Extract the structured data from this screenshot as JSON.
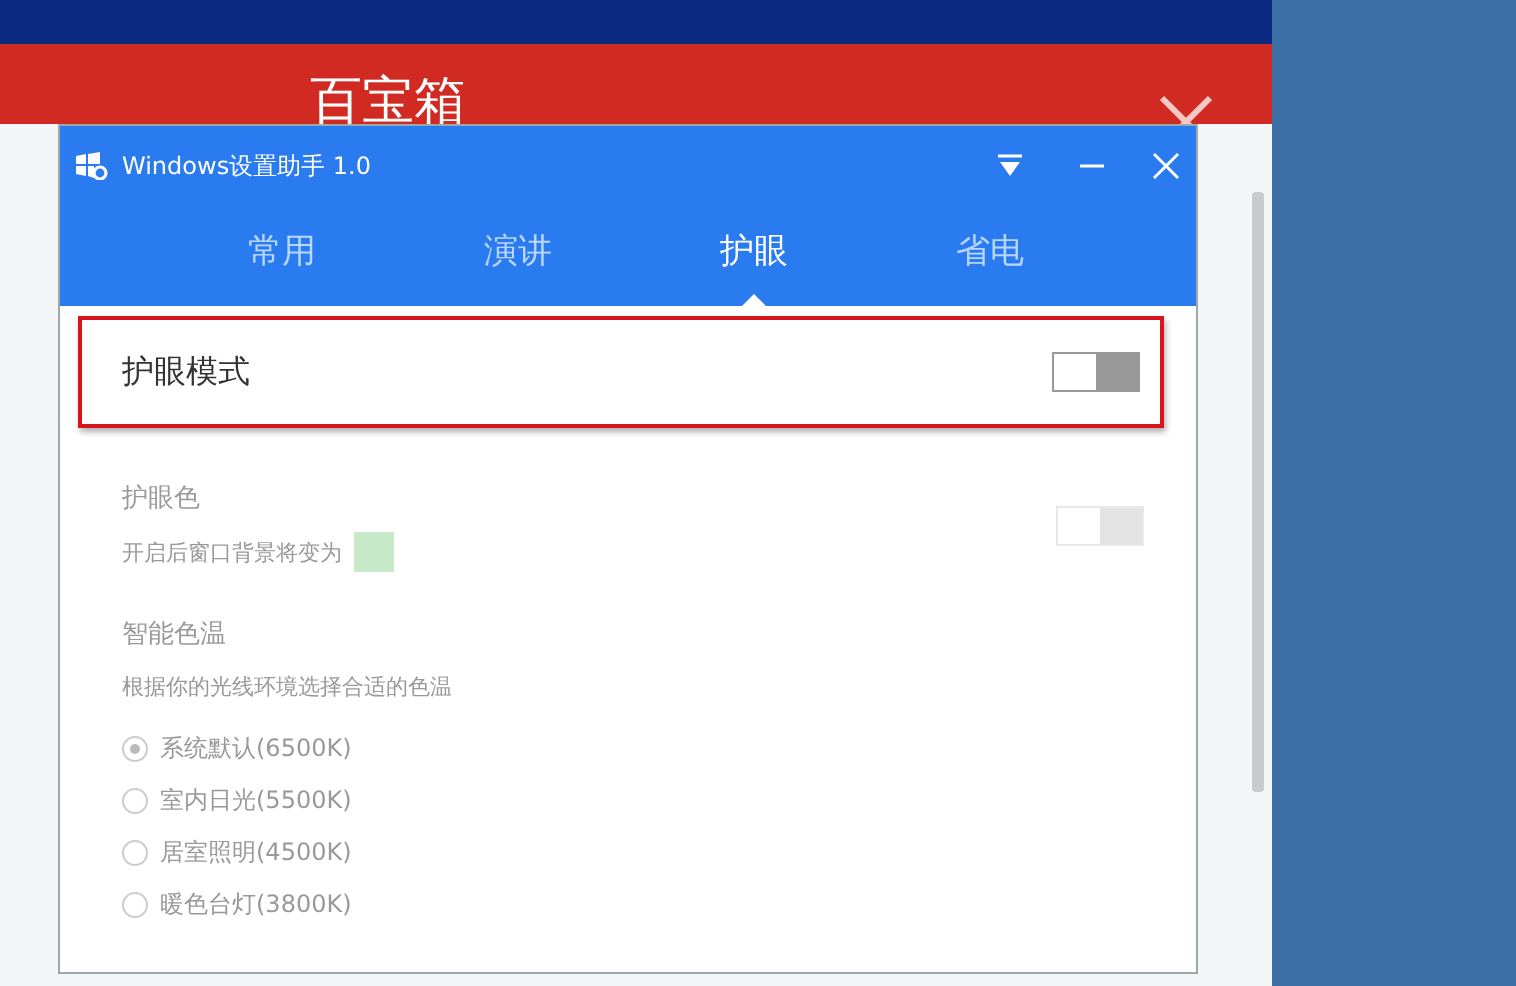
{
  "background_app": {
    "title": "百宝箱"
  },
  "window": {
    "title": "Windows设置助手 1.0"
  },
  "tabs": [
    {
      "label": "常用",
      "selected": false
    },
    {
      "label": "演讲",
      "selected": false
    },
    {
      "label": "护眼",
      "selected": true
    },
    {
      "label": "省电",
      "selected": false
    }
  ],
  "eye_mode": {
    "label": "护眼模式",
    "on": false,
    "highlighted": true
  },
  "eye_color": {
    "title": "护眼色",
    "description": "开启后窗口背景将变为",
    "color": "#c6eac8",
    "on": false,
    "disabled": true
  },
  "color_temp": {
    "title": "智能色温",
    "description": "根据你的光线环境选择合适的色温",
    "disabled": true,
    "options": [
      {
        "label": "系统默认(6500K)",
        "selected": true
      },
      {
        "label": "室内日光(5500K)",
        "selected": false
      },
      {
        "label": "居室照明(4500K)",
        "selected": false
      },
      {
        "label": "暖色台灯(3800K)",
        "selected": false
      }
    ]
  }
}
